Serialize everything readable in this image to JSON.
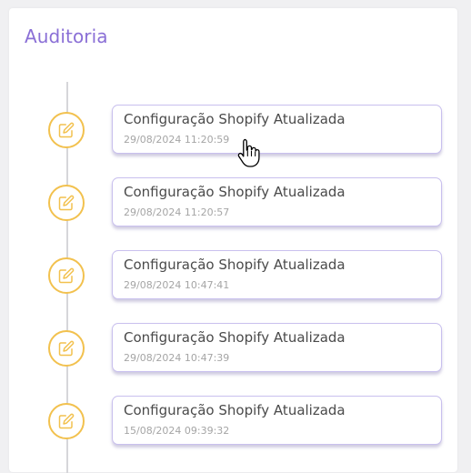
{
  "panel": {
    "title": "Auditoria"
  },
  "colors": {
    "title": "#8a6fd6",
    "icon_ring": "#f2c14e",
    "card_border": "#c9c0ee"
  },
  "timeline": {
    "entries": [
      {
        "icon": "edit-icon",
        "title": "Configuração Shopify Atualizada",
        "timestamp": "29/08/2024 11:20:59"
      },
      {
        "icon": "edit-icon",
        "title": "Configuração Shopify Atualizada",
        "timestamp": "29/08/2024 11:20:57"
      },
      {
        "icon": "edit-icon",
        "title": "Configuração Shopify Atualizada",
        "timestamp": "29/08/2024 10:47:41"
      },
      {
        "icon": "edit-icon",
        "title": "Configuração Shopify Atualizada",
        "timestamp": "29/08/2024 10:47:39"
      },
      {
        "icon": "edit-icon",
        "title": "Configuração Shopify Atualizada",
        "timestamp": "15/08/2024 09:39:32"
      }
    ]
  },
  "cursor": {
    "icon": "hand-pointer-icon"
  }
}
